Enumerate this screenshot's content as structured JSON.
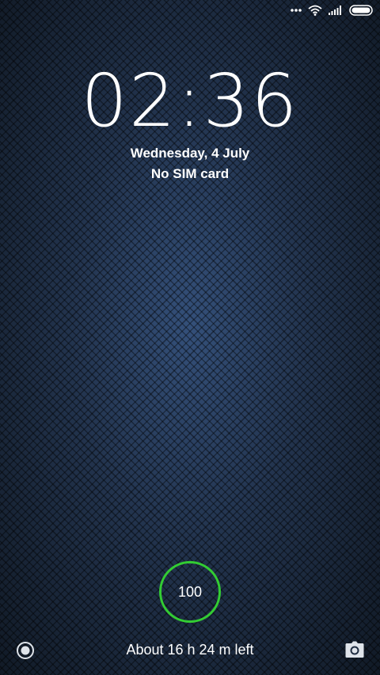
{
  "status_bar": {
    "icons": [
      "more-dots-icon",
      "wifi-icon",
      "signal-icon",
      "battery-icon"
    ]
  },
  "lock_screen": {
    "time": "02:36",
    "date": "Wednesday, 4 July",
    "sim_status": "No SIM card",
    "battery_level": "100",
    "battery_time_left": "About 16 h 24 m left",
    "accent_color": "#33cc33"
  },
  "shortcuts": {
    "left": "record-icon",
    "right": "camera-icon"
  }
}
